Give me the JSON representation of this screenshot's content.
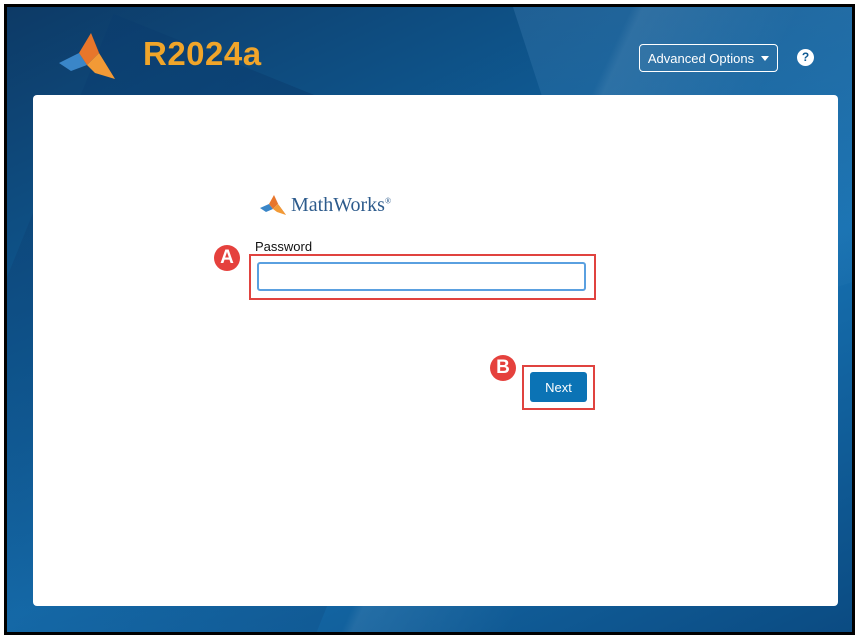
{
  "header": {
    "release": "R2024a",
    "advanced_options_label": "Advanced Options",
    "help_glyph": "?"
  },
  "login": {
    "brand": "MathWorks",
    "brand_mark": "®",
    "password_label": "Password",
    "password_value": "",
    "next_label": "Next"
  },
  "callouts": {
    "a": "A",
    "b": "B"
  },
  "colors": {
    "release_orange": "#f0a52a",
    "brand_blue": "#0b73b5",
    "callout_red": "#e5413d",
    "background_blue": "#0f5a93"
  },
  "icons": [
    "matlab-logo-icon",
    "chevron-down-icon",
    "help-icon",
    "mathworks-logo-icon"
  ]
}
